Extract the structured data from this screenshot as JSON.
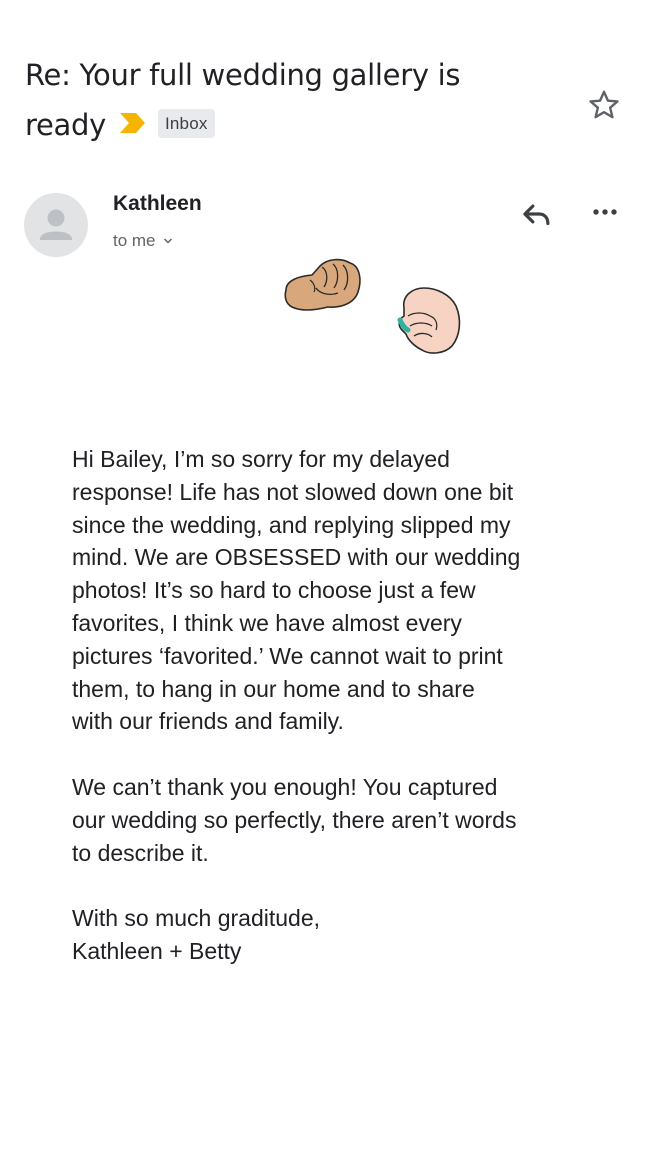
{
  "email": {
    "subject_line1": "Re: Your full wedding gallery is",
    "subject_line2": "ready",
    "label": "Inbox",
    "sender_name": "Kathleen",
    "recipient_text": "to me",
    "body": {
      "paragraph1": [
        "Hi Bailey, I’m so sorry for my delayed",
        "response! Life has not slowed down one bit",
        "since the wedding, and replying slipped my",
        "mind. We are OBSESSED with our wedding",
        "photos! It’s so hard to choose just a few",
        "favorites, I think we have almost every",
        "pictures ‘favorited.’ We cannot wait to print",
        "them, to hang in our home and to share",
        "with our friends and family."
      ],
      "paragraph2": [
        "We can’t thank you enough! You captured",
        "our wedding so perfectly, there aren’t words",
        "to describe it."
      ],
      "signoff": [
        "With so much graditude,",
        "Kathleen + Betty"
      ]
    }
  },
  "icons": {
    "importance": "importance-marker-icon",
    "star": "star-icon",
    "avatar": "default-avatar-icon",
    "chevron": "chevron-down-icon",
    "reply": "reply-icon",
    "more": "more-horizontal-icon",
    "sticker": "fist-bump-sticker"
  },
  "colors": {
    "importance": "#f4b400",
    "label_bg": "#e8eaed",
    "text": "#202124",
    "muted": "#5f6368",
    "skin_left": "#d9a77c",
    "skin_right": "#f6d3c2",
    "nail": "#2bb3a3"
  }
}
